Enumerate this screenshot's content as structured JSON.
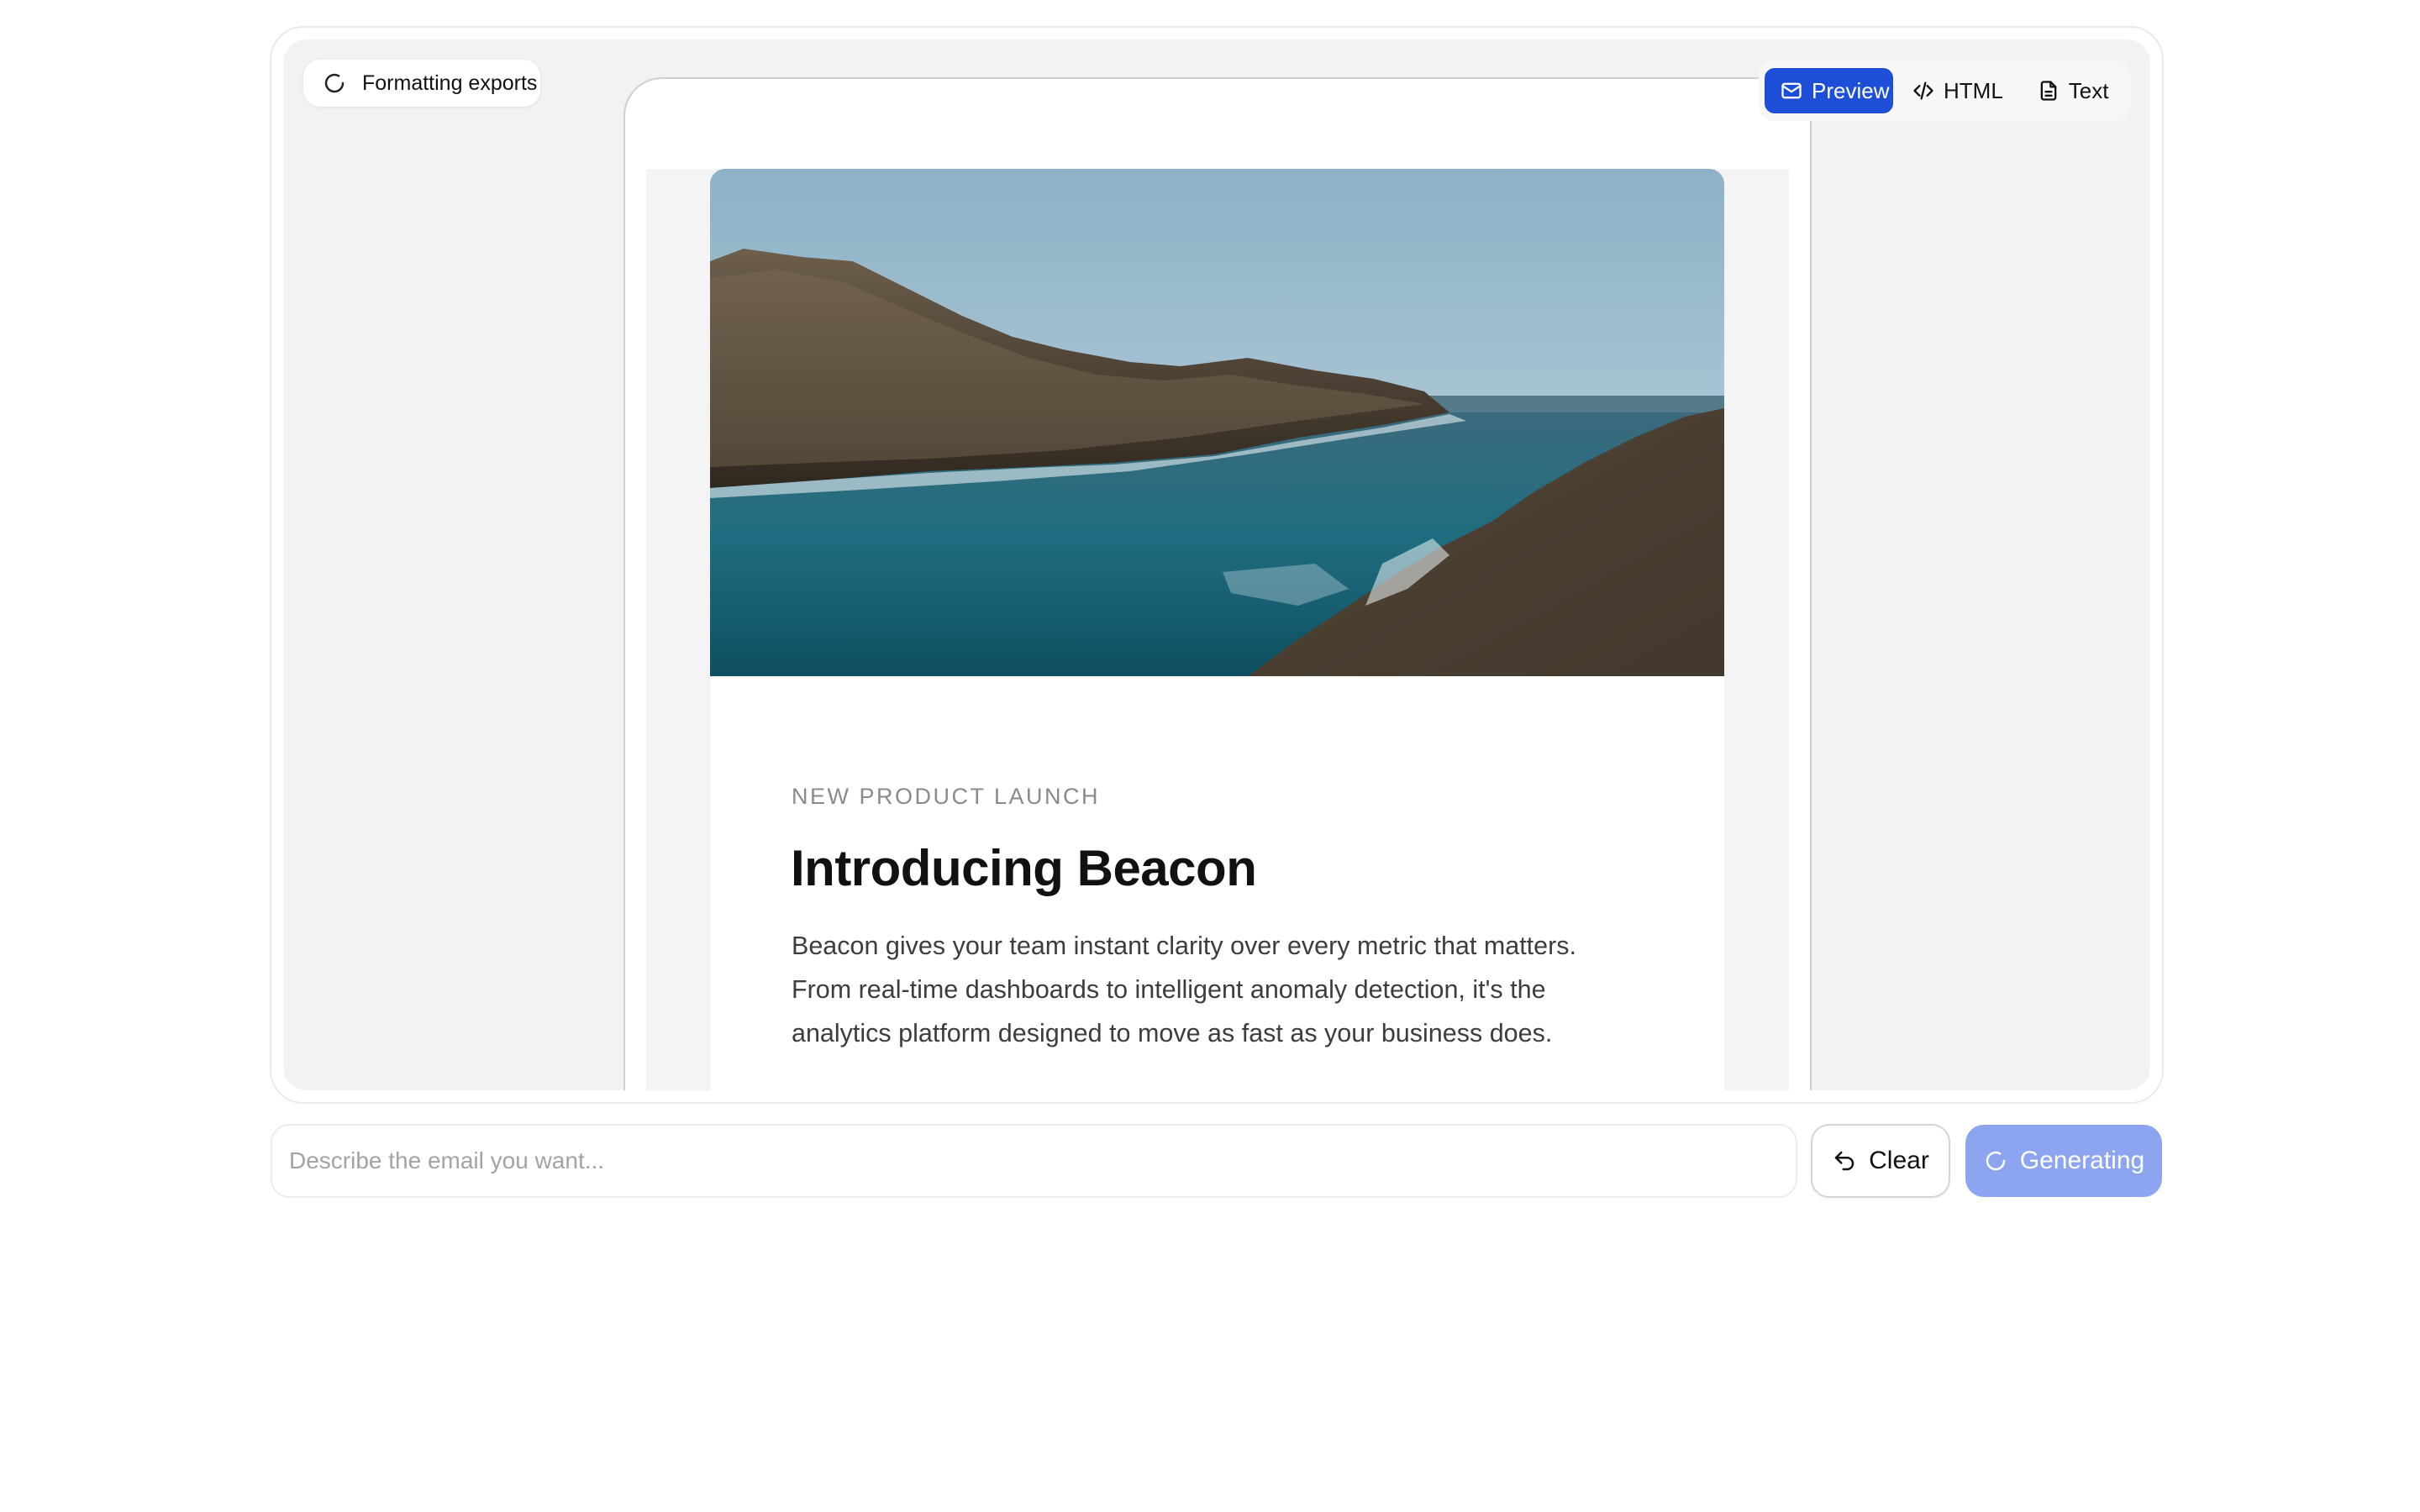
{
  "status": {
    "label": "Formatting exports",
    "icon": "loading-spinner-icon"
  },
  "view_tabs": [
    {
      "label": "Preview",
      "icon": "mail-icon",
      "active": true
    },
    {
      "label": "HTML",
      "icon": "code-icon",
      "active": false
    },
    {
      "label": "Text",
      "icon": "document-icon",
      "active": false
    }
  ],
  "email": {
    "hero_image": "rocky-coastline-photo",
    "eyebrow": "NEW PRODUCT LAUNCH",
    "headline": "Introducing Beacon",
    "body": "Beacon gives your team instant clarity over every metric that matters. From real-time dashboards to intelligent anomaly detection, it's the analytics platform designed to move as fast as your business does."
  },
  "prompt": {
    "placeholder": "Describe the email you want...",
    "value": ""
  },
  "actions": {
    "clear_label": "Clear",
    "generate_label": "Generating"
  },
  "colors": {
    "accent": "#1d4ed8",
    "generate_disabled": "#8da4f1",
    "stage_bg": "#f2f2f2"
  }
}
